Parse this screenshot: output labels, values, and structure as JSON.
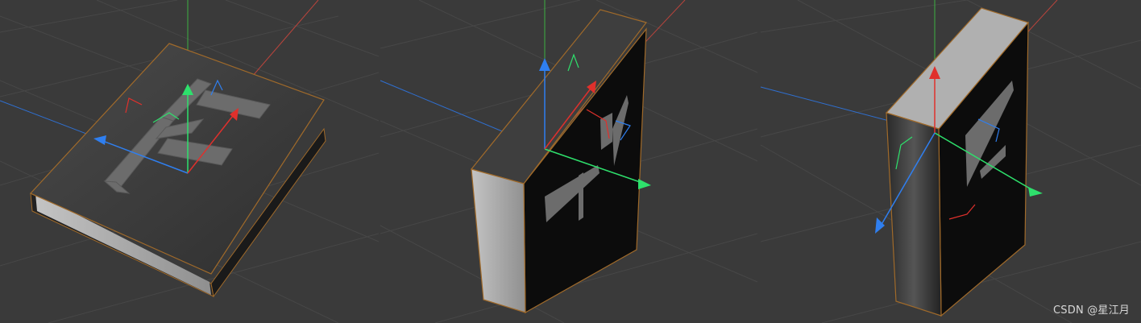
{
  "watermark": {
    "text": "CSDN @星江月"
  },
  "scene": {
    "viewports": [
      {
        "name": "book-lying-flat",
        "object": "book",
        "pose": "flat"
      },
      {
        "name": "book-standing-spine-left",
        "object": "book",
        "pose": "upright-rotated"
      },
      {
        "name": "book-standing-spine-front",
        "object": "book",
        "pose": "upright-spine-front"
      }
    ],
    "colors": {
      "background": "#3a3a3a",
      "grid": "#4a4a4a",
      "axis_x_world": "#c0443c",
      "axis_y_world": "#3cb043",
      "axis_z_world": "#2f6fd0",
      "gizmo_x": "#e0302c",
      "gizmo_y": "#2ee06c",
      "gizmo_z": "#2f7ff0",
      "book_cover": "#3c3c3c",
      "book_dark": "#0e0e0e",
      "book_pages": "#a9a9a9",
      "selection_outline": "#a06a2a",
      "emboss": "#6e6e6e"
    },
    "icons": [
      "axis-gizmo-icon",
      "letter-e-emboss-icon"
    ]
  }
}
